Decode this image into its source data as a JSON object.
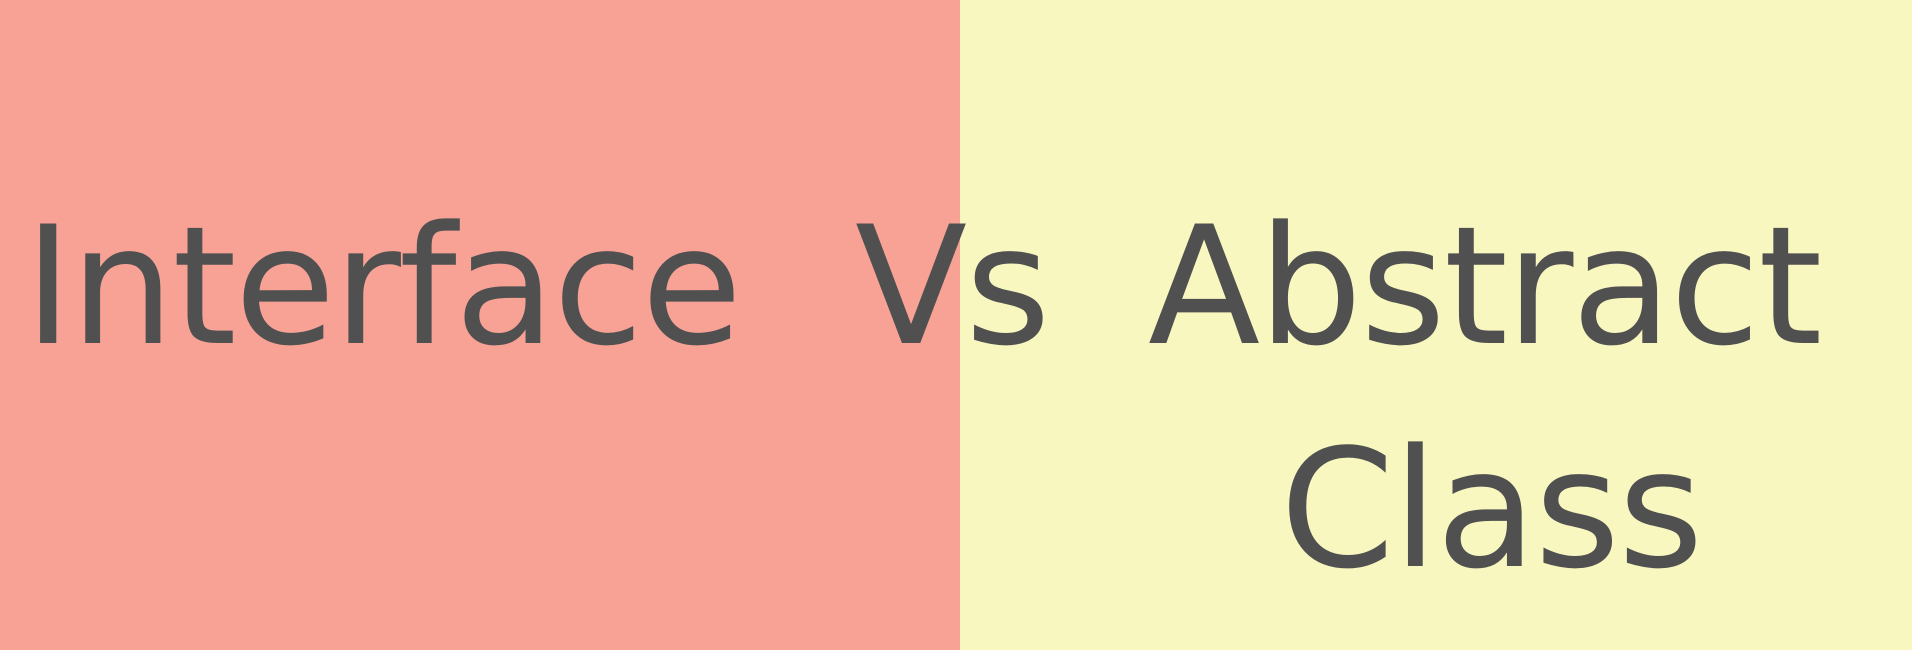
{
  "colors": {
    "left_panel": "#F7A295",
    "right_panel": "#F8F7BF",
    "text": "#505050"
  },
  "heading": {
    "left_term": "Interface",
    "separator": "Vs",
    "right_term_line1": "Abstract",
    "right_term_line2": "Class"
  }
}
